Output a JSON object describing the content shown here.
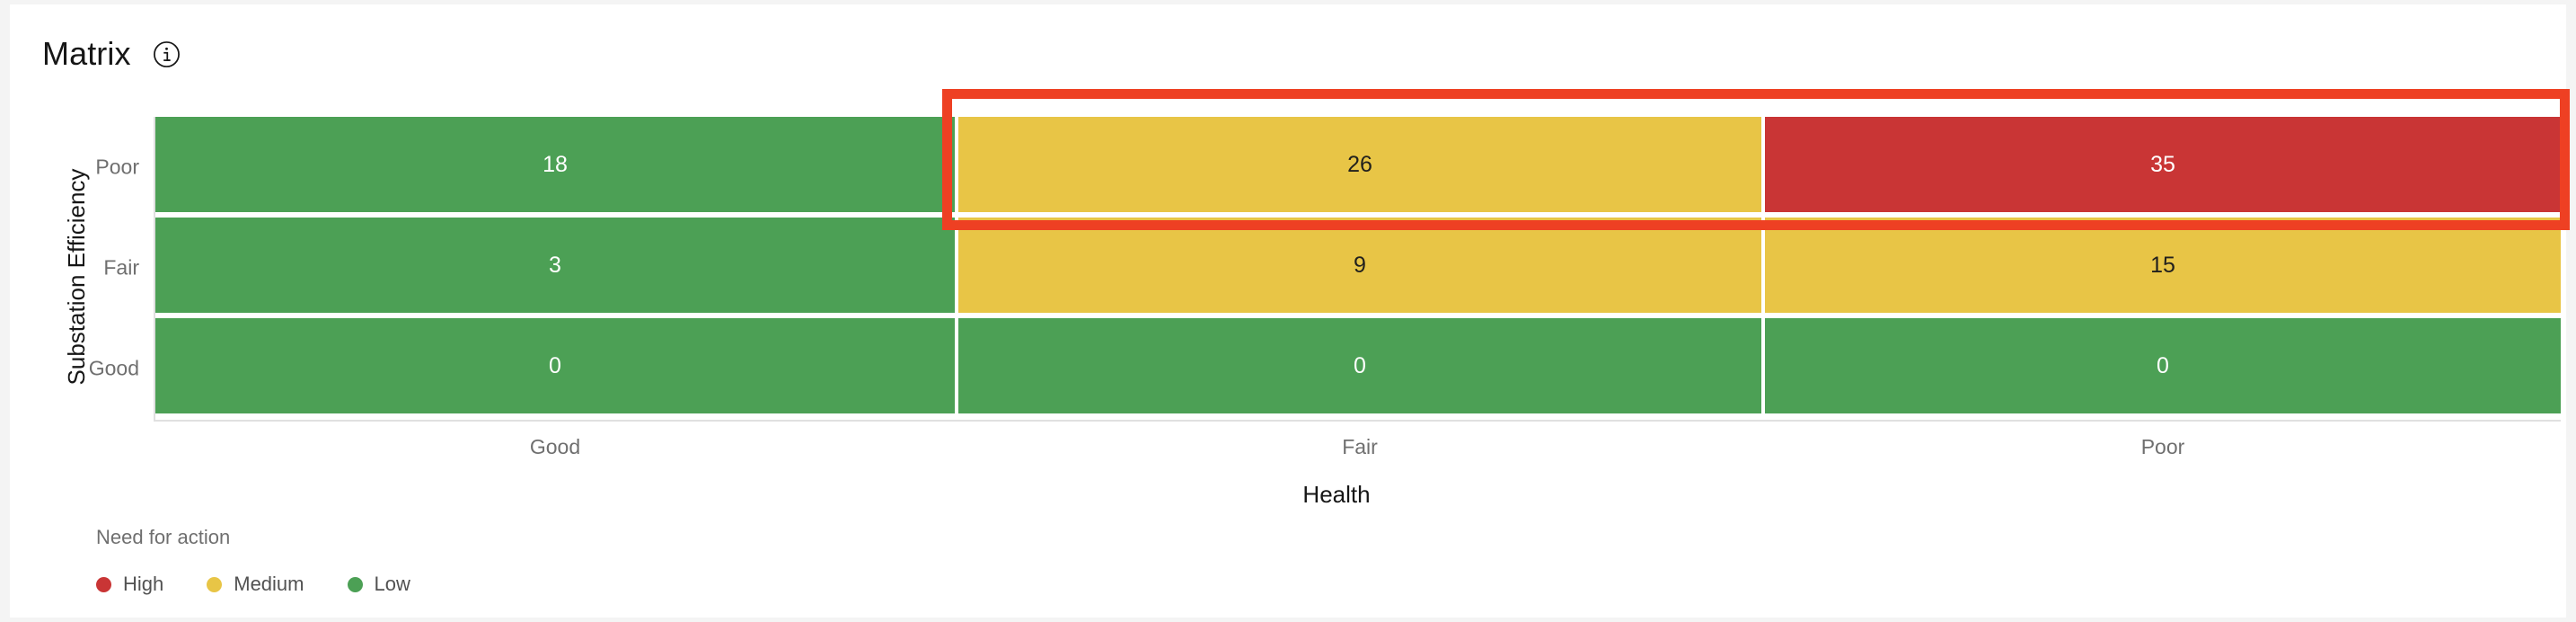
{
  "header": {
    "title": "Matrix",
    "info_icon": "info-circle-icon"
  },
  "chart_data": {
    "type": "heatmap",
    "title": "Matrix",
    "xlabel": "Health",
    "ylabel": "Substation Efficiency",
    "x_categories": [
      "Good",
      "Fair",
      "Poor"
    ],
    "y_categories": [
      "Poor",
      "Fair",
      "Good"
    ],
    "cells": [
      [
        {
          "value": "18",
          "level": "low"
        },
        {
          "value": "26",
          "level": "medium"
        },
        {
          "value": "35",
          "level": "high"
        }
      ],
      [
        {
          "value": "3",
          "level": "low"
        },
        {
          "value": "9",
          "level": "medium"
        },
        {
          "value": "15",
          "level": "medium"
        }
      ],
      [
        {
          "value": "0",
          "level": "low"
        },
        {
          "value": "0",
          "level": "low"
        },
        {
          "value": "0",
          "level": "low"
        }
      ]
    ],
    "legend": {
      "title": "Need for action",
      "position": "bottom-left",
      "entries": [
        {
          "label": "High",
          "color": "#c93535"
        },
        {
          "label": "Medium",
          "color": "#e8c546"
        },
        {
          "label": "Low",
          "color": "#4ca055"
        }
      ]
    },
    "grid": false,
    "annotation": {
      "shape": "rectangle",
      "color": "#ee4023",
      "covers_row": "Poor",
      "covers_columns": [
        "Fair",
        "Poor"
      ]
    }
  },
  "colors": {
    "low": "#4ca055",
    "medium": "#e8c546",
    "high": "#c93535",
    "highlight": "#ee4023",
    "page_bg": "#f4f4f4",
    "card_bg": "#ffffff"
  }
}
